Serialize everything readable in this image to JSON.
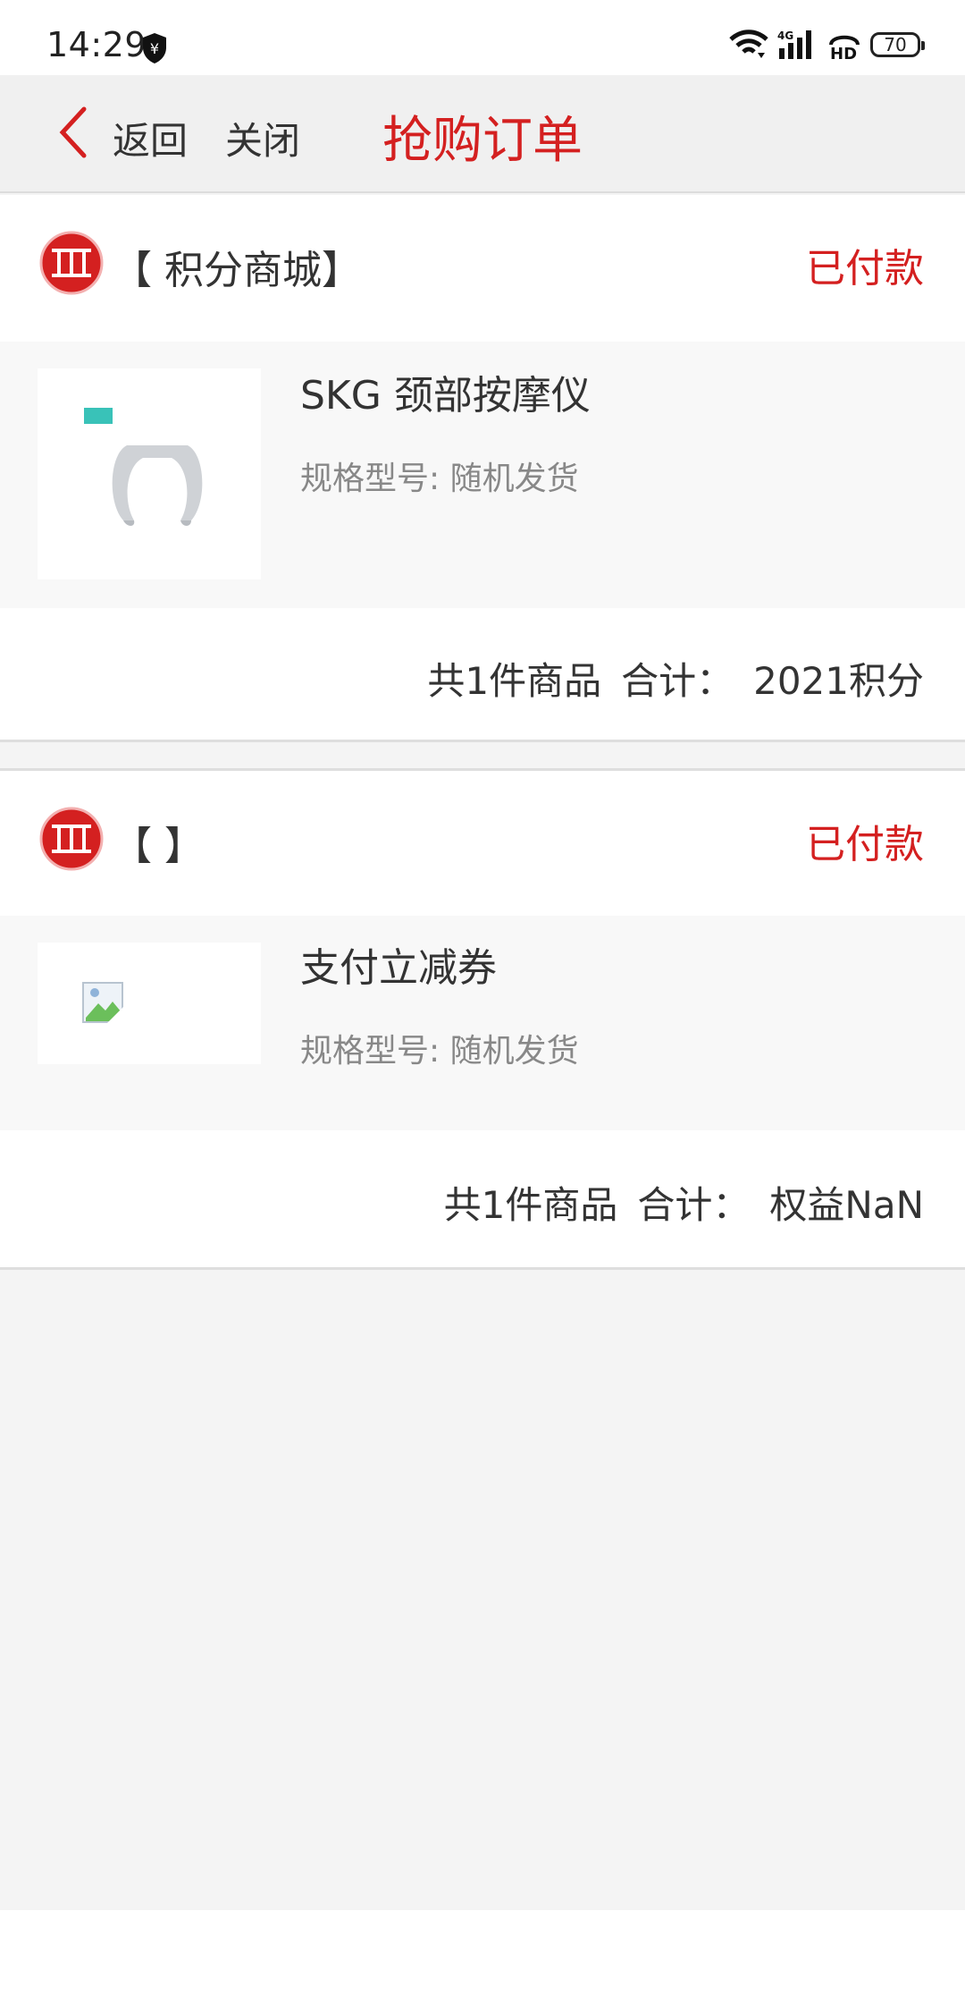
{
  "status_bar": {
    "time": "14:29",
    "battery": "70",
    "icons": [
      "yuan-shield-icon",
      "wifi-icon",
      "signal-4g-icon",
      "hd-icon",
      "battery-icon"
    ]
  },
  "nav": {
    "back_label": "返回",
    "close_label": "关闭",
    "title": "抢购订单"
  },
  "colors": {
    "accent": "#d42020",
    "nav_bg": "#f0f0f0",
    "page_bg": "#f4f4f4"
  },
  "orders": [
    {
      "shop": "【 积分商城】",
      "status": "已付款",
      "item_title": "SKG 颈部按摩仪",
      "item_spec": "规格型号: 随机发货",
      "count_label": "共1件商品",
      "total_label": "合计：",
      "total_value": "2021积分"
    },
    {
      "shop": "【  】",
      "status": "已付款",
      "item_title": "支付立减券",
      "item_spec": "规格型号: 随机发货",
      "count_label": "共1件商品",
      "total_label": "合计：",
      "total_value": "权益NaN"
    }
  ]
}
